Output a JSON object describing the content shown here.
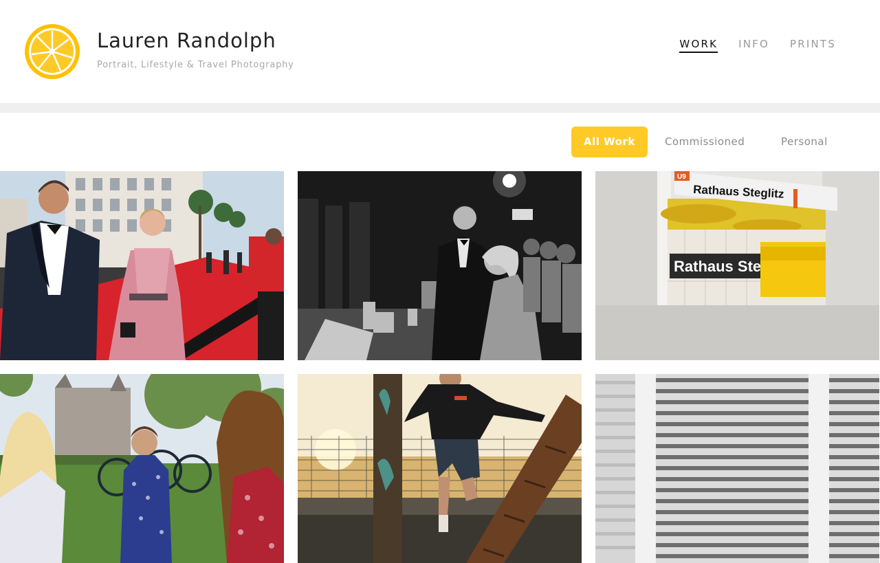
{
  "header": {
    "logo_icon": "lemon-slice-icon",
    "site_name": "Lauren Randolph",
    "tagline": "Portrait, Lifestyle & Travel Photography"
  },
  "nav": {
    "items": [
      {
        "label": "WORK",
        "active": true
      },
      {
        "label": "INFO",
        "active": false
      },
      {
        "label": "PRINTS",
        "active": false
      }
    ]
  },
  "filters": {
    "items": [
      {
        "label": "All Work",
        "active": true
      },
      {
        "label": "Commissioned",
        "active": false
      },
      {
        "label": "Personal",
        "active": false
      }
    ]
  },
  "gallery": {
    "photos": [
      {
        "subject": "red-carpet-couple"
      },
      {
        "subject": "backstage-black-and-white"
      },
      {
        "subject": "subway-station",
        "sign_primary": "Rathaus Steglitz",
        "sign_line": "U9",
        "sign_wall": "Rathaus Steglitz"
      },
      {
        "subject": "picnic-friends"
      },
      {
        "subject": "climbing-bridge-sunset"
      },
      {
        "subject": "window-shutters"
      }
    ]
  },
  "colors": {
    "accent": "#ffca28",
    "nav_active": "#111111",
    "nav_inactive": "#9a9a9a",
    "band": "#efefef"
  }
}
